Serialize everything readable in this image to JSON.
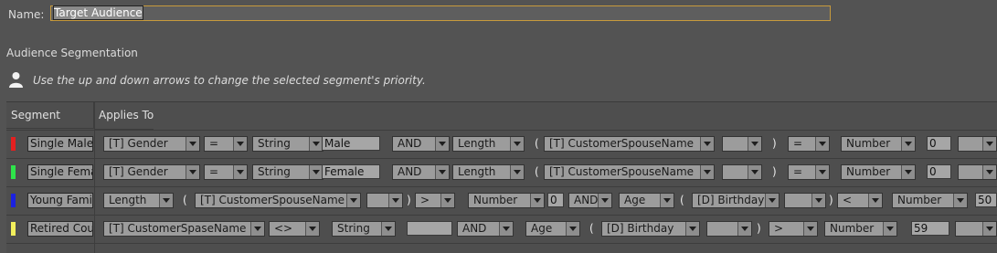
{
  "name": {
    "label": "Name:",
    "value": "Target Audience"
  },
  "section_title": "Audience Segmentation",
  "hint": "Use the up and down arrows to change the selected segment's priority.",
  "table": {
    "headers": {
      "segment": "Segment",
      "applies_to": "Applies To"
    },
    "rows": [
      {
        "segment": "Single Males",
        "color": "#e32020",
        "field1": "[T] Gender",
        "op1": "=",
        "type1": "String",
        "value1": "Male",
        "conj": "AND",
        "func": "Length",
        "paren_open": "(",
        "field2": "[T] CustomerSpouseName",
        "blank1": "",
        "paren_close": ")",
        "op2": "=",
        "type2": "Number",
        "value2": "0",
        "blank2": ""
      },
      {
        "segment": "Single Female",
        "color": "#2ee34a",
        "field1": "[T] Gender",
        "op1": "=",
        "type1": "String",
        "value1": "Female",
        "conj": "AND",
        "func": "Length",
        "paren_open": "(",
        "field2": "[T] CustomerSpouseName",
        "blank1": "",
        "paren_close": ")",
        "op2": "=",
        "type2": "Number",
        "value2": "0",
        "blank2": ""
      },
      {
        "segment": "Young Familie",
        "color": "#1b22e0",
        "func": "Length",
        "paren_open": "(",
        "field1": "[T] CustomerSpouseName",
        "blank1": "",
        "paren_close": ")",
        "op1": ">",
        "type1": "Number",
        "value1": "0",
        "conj": "AND",
        "field2": "Age",
        "paren_open2": "(",
        "field3": "[D] Birthday",
        "blank2": "",
        "paren_close2": ")",
        "op2": "<",
        "type2": "Number",
        "value2": "50"
      },
      {
        "segment": "Retired Coup",
        "color": "#f2ef5c",
        "field1": "[T] CustomerSpaseName",
        "op1": "<>",
        "type1": "String",
        "value1": "",
        "conj": "AND",
        "field2": "Age",
        "paren_open": "(",
        "field3": "[D] Birthday",
        "blank1": "",
        "paren_close": ")",
        "op2": ">",
        "type2": "Number",
        "value2": "59",
        "blank2": ""
      }
    ]
  }
}
